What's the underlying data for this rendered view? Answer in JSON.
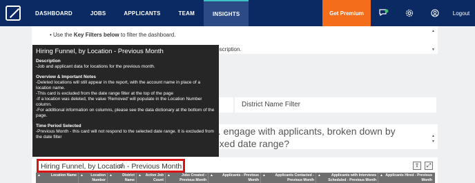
{
  "nav": {
    "items": [
      "DASHBOARD",
      "JOBS",
      "APPLICANTS",
      "TEAM",
      "INSIGHTS"
    ],
    "active": "INSIGHTS",
    "premium_label": "Get Premium",
    "logout_label": "Logout"
  },
  "intro": {
    "bullet_bold": "Key Filters below",
    "bullet_prefix": "Use the ",
    "bullet_suffix": " to filter the dashboard.",
    "line2_fragment": "'s description."
  },
  "filters": {
    "district_label": "District Name Filter"
  },
  "question": {
    "line1": "... engage with applicants, broken down by",
    "line2": "over a fixed date range?"
  },
  "table": {
    "title": "Hiring Funnel, by Location - Previous Month",
    "columns": [
      "Location Name",
      "Location Number",
      "District Name",
      "Active Job Count",
      "Jobs Created - Previous Month",
      "Applicants - Previous Month",
      "Applicants Contacted - Previous Month",
      "Applicants with Interviews Scheduled - Previous Month",
      "Applicants Hired - Previous Month"
    ]
  },
  "tooltip": {
    "title": "Hiring Funnel, by Location - Previous Month",
    "sections": [
      {
        "heading": "Description",
        "lines": [
          "-Job and applicant data for locations for the previous month."
        ]
      },
      {
        "heading": "Overview & Important Notes",
        "lines": [
          "-Deleted locations will still appear in the report, with the account name in place of a location name.",
          "-This card is excluded from the date range filter at the top of the page",
          "-If a location was deleted, the value 'Removed' will populate in the Location Number column.",
          "-For additional information on columns, please see the data dictionary at the bottom of the page."
        ]
      },
      {
        "heading": "Time Period Selected",
        "lines": [
          "-Previous Month - this card will not respond to the selected date range. It is excluded from the date filter"
        ]
      }
    ]
  }
}
